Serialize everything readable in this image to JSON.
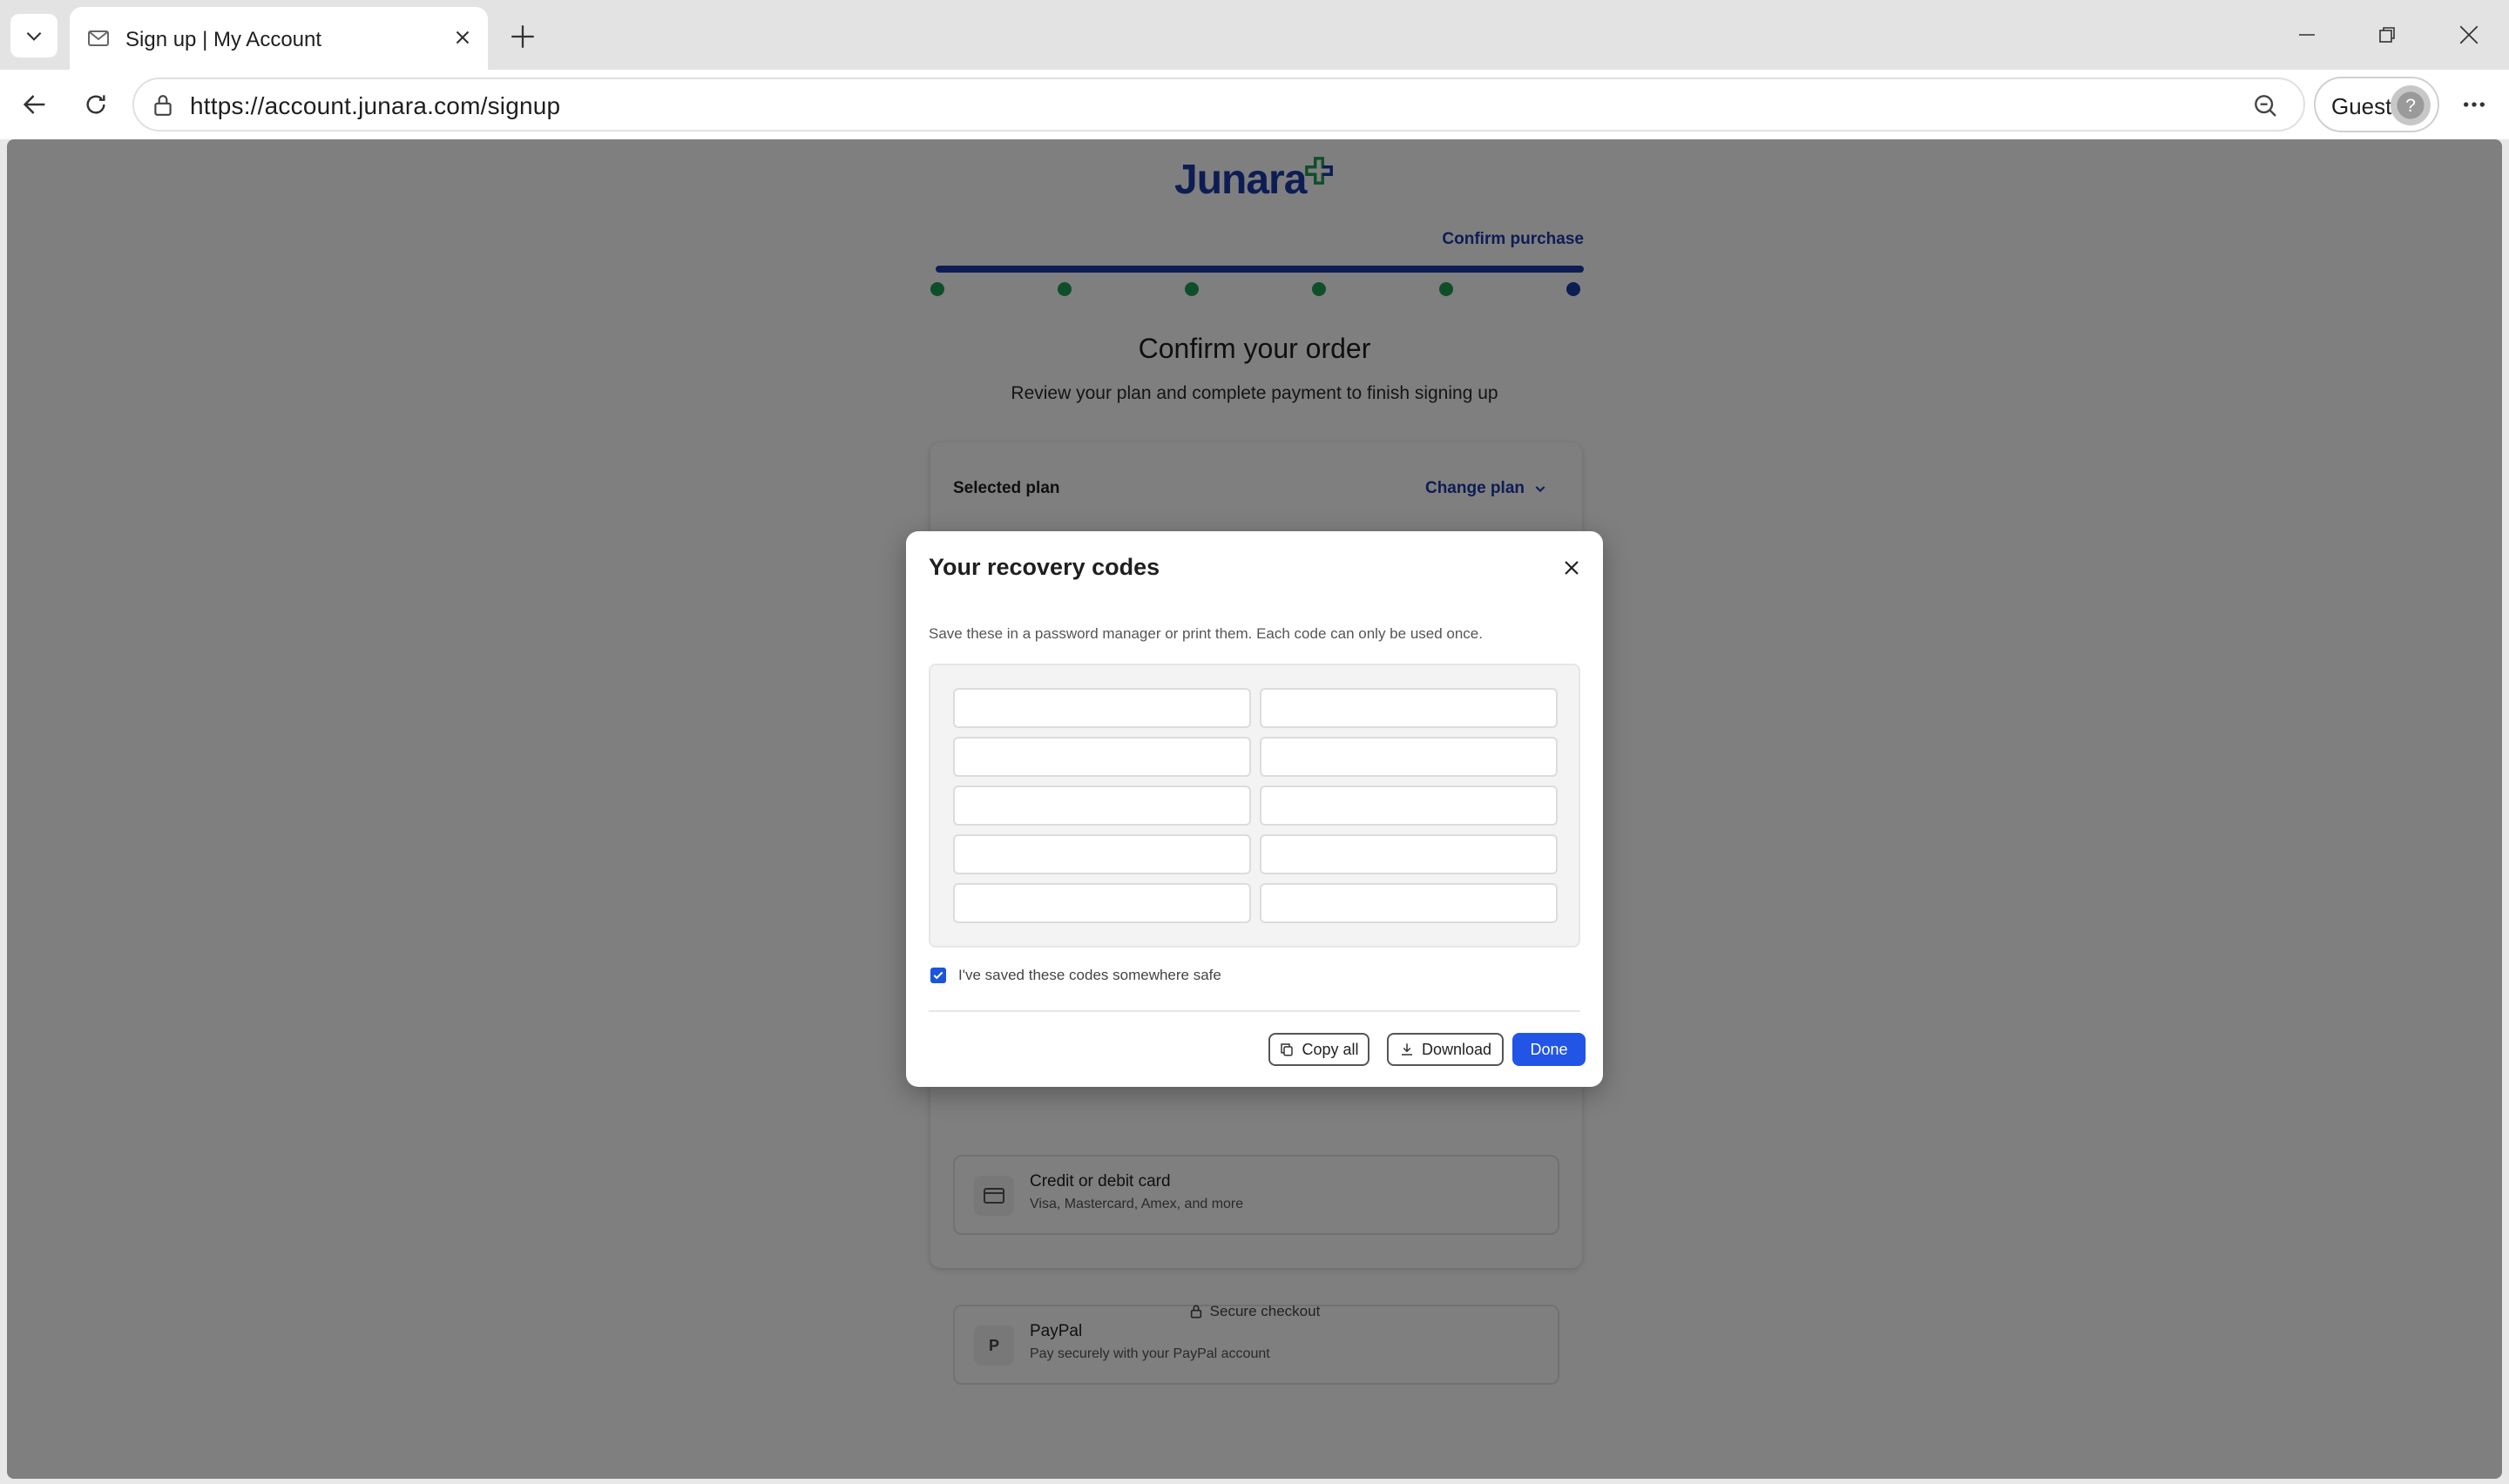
{
  "browser": {
    "tab_title": "Sign up | My Account",
    "url": "https://account.junara.com/signup",
    "profile_label": "Guest"
  },
  "page": {
    "logo_text": "Junara",
    "step_label": "Confirm purchase",
    "steps_total": 6,
    "steps_completed": 5,
    "title": "Confirm your order",
    "subtitle": "Review your plan and complete payment to finish signing up",
    "selected_plan_label": "Selected plan",
    "change_plan_label": "Change plan",
    "payment_options": [
      {
        "icon": "credit-card-icon",
        "title": "Credit or debit card",
        "desc": "Visa, Mastercard, Amex, and more"
      },
      {
        "icon_letter": "P",
        "title": "PayPal",
        "desc": "Pay securely with your PayPal account"
      }
    ],
    "secure_label": "Secure checkout"
  },
  "modal": {
    "title": "Your recovery codes",
    "description": "Save these in a password manager or print them. Each code can only be used once.",
    "codes": [
      "",
      "",
      "",
      "",
      "",
      "",
      "",
      "",
      "",
      ""
    ],
    "confirm_label": "I've saved these codes somewhere safe",
    "confirm_checked": true,
    "copy_all_label": "Copy all",
    "download_label": "Download",
    "done_label": "Done"
  },
  "colors": {
    "brand": "#1a3aa8",
    "step_done": "#1f9d55",
    "primary_button": "#2255e6"
  }
}
